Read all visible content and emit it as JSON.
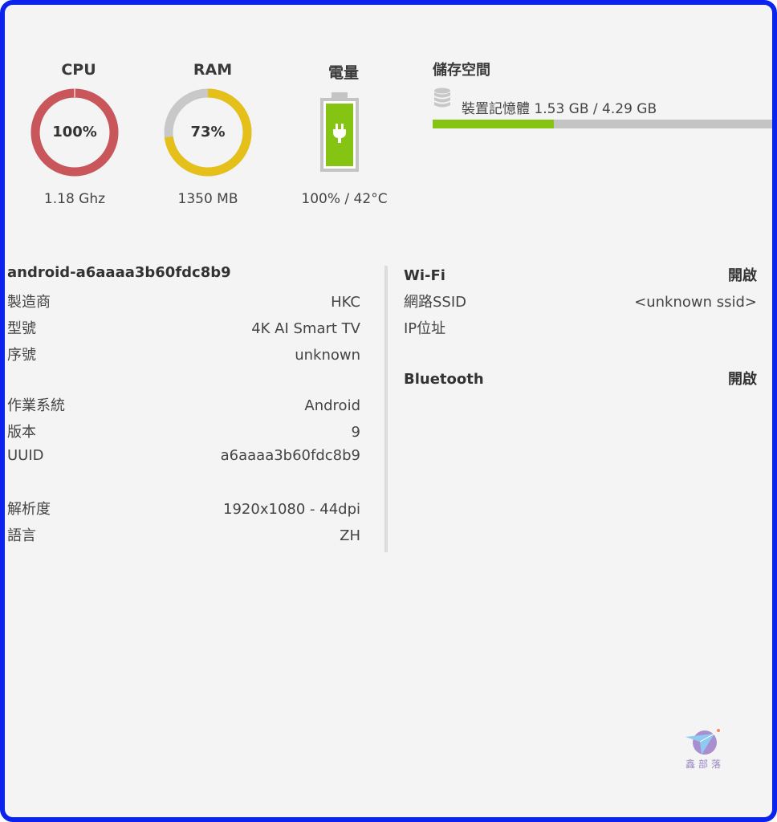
{
  "gauges": {
    "cpu": {
      "title": "CPU",
      "percent_label": "100%",
      "percent": 100,
      "sub": "1.18 Ghz",
      "color": "#c9565a",
      "track": "#e8a8a8"
    },
    "ram": {
      "title": "RAM",
      "percent_label": "73%",
      "percent": 73,
      "sub": "1350 MB",
      "color": "#e5c01a",
      "track": "#c8c8c8"
    },
    "battery": {
      "title": "電量",
      "level_percent": 100,
      "sub": "100% / 42°C",
      "fill_color": "#86c414",
      "icon": "battery-charging-icon"
    }
  },
  "storage": {
    "title": "儲存空間",
    "icon": "database-icon",
    "label": "裝置記憶體 1.53 GB / 4.29 GB",
    "used_gb": 1.53,
    "total_gb": 4.29,
    "fill_color": "#86c414"
  },
  "device": {
    "hostname": "android-a6aaaa3b60fdc8b9",
    "groups": [
      [
        {
          "key": "製造商",
          "value": "HKC"
        },
        {
          "key": "型號",
          "value": "4K AI Smart TV"
        },
        {
          "key": "序號",
          "value": "unknown"
        }
      ],
      [
        {
          "key": "作業系統",
          "value": "Android"
        },
        {
          "key": "版本",
          "value": "9"
        },
        {
          "key": "UUID",
          "value": "a6aaaa3b60fdc8b9"
        }
      ],
      [
        {
          "key": "解析度",
          "value": "1920x1080 - 44dpi"
        },
        {
          "key": "語言",
          "value": "ZH"
        }
      ]
    ]
  },
  "network": {
    "wifi": {
      "label": "Wi-Fi",
      "status": "開啟",
      "ssid_label": "網路SSID",
      "ssid_value": "<unknown ssid>",
      "ip_label": "IP位址",
      "ip_value": ""
    },
    "bluetooth": {
      "label": "Bluetooth",
      "status": "開啟"
    }
  },
  "watermark": {
    "text": "鑫部落",
    "icon": "paper-plane-logo-icon"
  }
}
